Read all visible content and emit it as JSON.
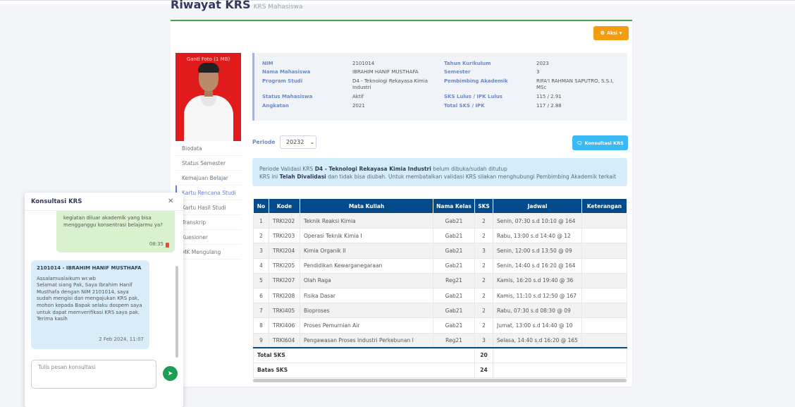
{
  "header": {
    "title": "Riwayat KRS",
    "subtitle": "KRS Mahasiswa"
  },
  "toolbar": {
    "aksi_label": "Aksi"
  },
  "profile": {
    "change_photo_label": "Ganti Foto (1 MB)"
  },
  "sidebar": {
    "items": [
      {
        "label": "Biodata"
      },
      {
        "label": "Status Semester"
      },
      {
        "label": "Kemajuan Belajar"
      },
      {
        "label": "Kartu Rencana Studi"
      },
      {
        "label": "Kartu Hasil Studi"
      },
      {
        "label": "Transkrip"
      },
      {
        "label": "Kuesioner"
      },
      {
        "label": "MK Mengulang"
      }
    ],
    "active_index": 3
  },
  "student": {
    "nim_label": "NIM",
    "nim": "2101014",
    "nama_label": "Nama Mahasiswa",
    "nama": "IBRAHIM HANIF MUSTHAFA",
    "prodi_label": "Program Studi",
    "prodi": "D4 - Teknologi Rekayasa Kimia Industri",
    "status_label": "Status Mahasiswa",
    "status": "Aktif",
    "angkatan_label": "Angkatan",
    "angkatan": "2021",
    "kurikulum_label": "Tahun Kurikulum",
    "kurikulum": "2023",
    "semester_label": "Semester",
    "semester": "3",
    "pembimbing_label": "Pembimbing Akademik",
    "pembimbing": "RIFA'I RAHMAN SAPUTRO, S.S.I, MSc",
    "sks_lulus_label": "SKS Lulus / IPK Lulus",
    "sks_lulus": "115 / 2.91",
    "total_sks_label": "Total SKS / IPK",
    "total_sks": "117 / 2.88"
  },
  "periode": {
    "label": "Periode",
    "value": "20232"
  },
  "konsultasi_button": "Konsultasi KRS",
  "alert": {
    "l1_pre": "Periode Validasi KRS ",
    "l1_bold": "D4 - Teknologi Rekayasa Kimia Industri",
    "l1_post": " belum dibuka/sudah ditutup",
    "l2_pre": "KRS ini ",
    "l2_bold": "Telah Divalidasi",
    "l2_post": " dan tidak bisa diubah. Untuk membatalkan validasi KRS silakan menghubungi Pembimbing Akademik terkait"
  },
  "table": {
    "headers": [
      "No",
      "Kode",
      "Mata Kuliah",
      "Nama Kelas",
      "SKS",
      "Jadwal",
      "Keterangan"
    ],
    "rows": [
      [
        "1",
        "TRKI202",
        "Teknik Reaksi Kimia",
        "Gab21",
        "2",
        "Senin, 07:30 s.d 10:10 @ 164",
        ""
      ],
      [
        "2",
        "TRKI203",
        "Operasi Teknik Kimia I",
        "Gab21",
        "2",
        "Rabu, 13:00 s.d 14:40 @ 12",
        ""
      ],
      [
        "3",
        "TRKI204",
        "Kimia Organik II",
        "Gab21",
        "3",
        "Senin, 12:00 s.d 13:50 @ 09",
        ""
      ],
      [
        "4",
        "TRKI205",
        "Pendidikan Kewarganegaraan",
        "Gab21",
        "2",
        "Senin, 14:40 s.d 16:20 @ 164",
        ""
      ],
      [
        "5",
        "TRKI207",
        "Olah Raga",
        "Reg21",
        "2",
        "Kamis, 16:20 s.d 19:40 @ 36",
        ""
      ],
      [
        "6",
        "TRKI208",
        "Fisika Dasar",
        "Gab21",
        "2",
        "Kamis, 11:10 s.d 12:50 @ 167",
        ""
      ],
      [
        "7",
        "TRKI405",
        "Bioproses",
        "Gab21",
        "2",
        "Rabu, 07:30 s.d 08:30 @ 09",
        ""
      ],
      [
        "8",
        "TRKI406",
        "Proses Pemurnian Air",
        "Gab21",
        "2",
        "Jumat, 13:00 s.d 14:40 @ 10",
        ""
      ],
      [
        "9",
        "TRKI604",
        "Pengawasan Proses Industri Perkebunan I",
        "Reg21",
        "3",
        "Selasa, 14:40 s.d 16:20 @ 165",
        ""
      ]
    ],
    "total_label": "Total SKS",
    "total_value": "20",
    "batas_label": "Batas SKS",
    "batas_value": "24"
  },
  "chat": {
    "title": "Konsultasi KRS",
    "my_message": "kegiatan diluar akademik yang bisa mengganggu konsentrasi belajarmu ya?",
    "my_time": "08:35",
    "advisor_from": "2101014 - IBRAHIM HANIF MUSTHAFA",
    "advisor_message": "Assalamualaikum wr.wb\nSelamat siang Pak, Saya Ibrahim Hanif Musthafa dengan NIM 2101014, saya sudah mengisi dan mengajukan KRS pak, mohon kepada Bapak selaku dospem saya untuk dapat memverifikasi KRS saya pak.\nTerima kasih",
    "advisor_time": "2 Feb 2024, 11:07",
    "input_placeholder": "Tulis pesan konsultasi"
  },
  "colors": {
    "accent": "#6777ef",
    "header": "#034a8a",
    "aksi": "#f39c12",
    "konsultasi": "#3abaf4",
    "send": "#1f9d55"
  }
}
